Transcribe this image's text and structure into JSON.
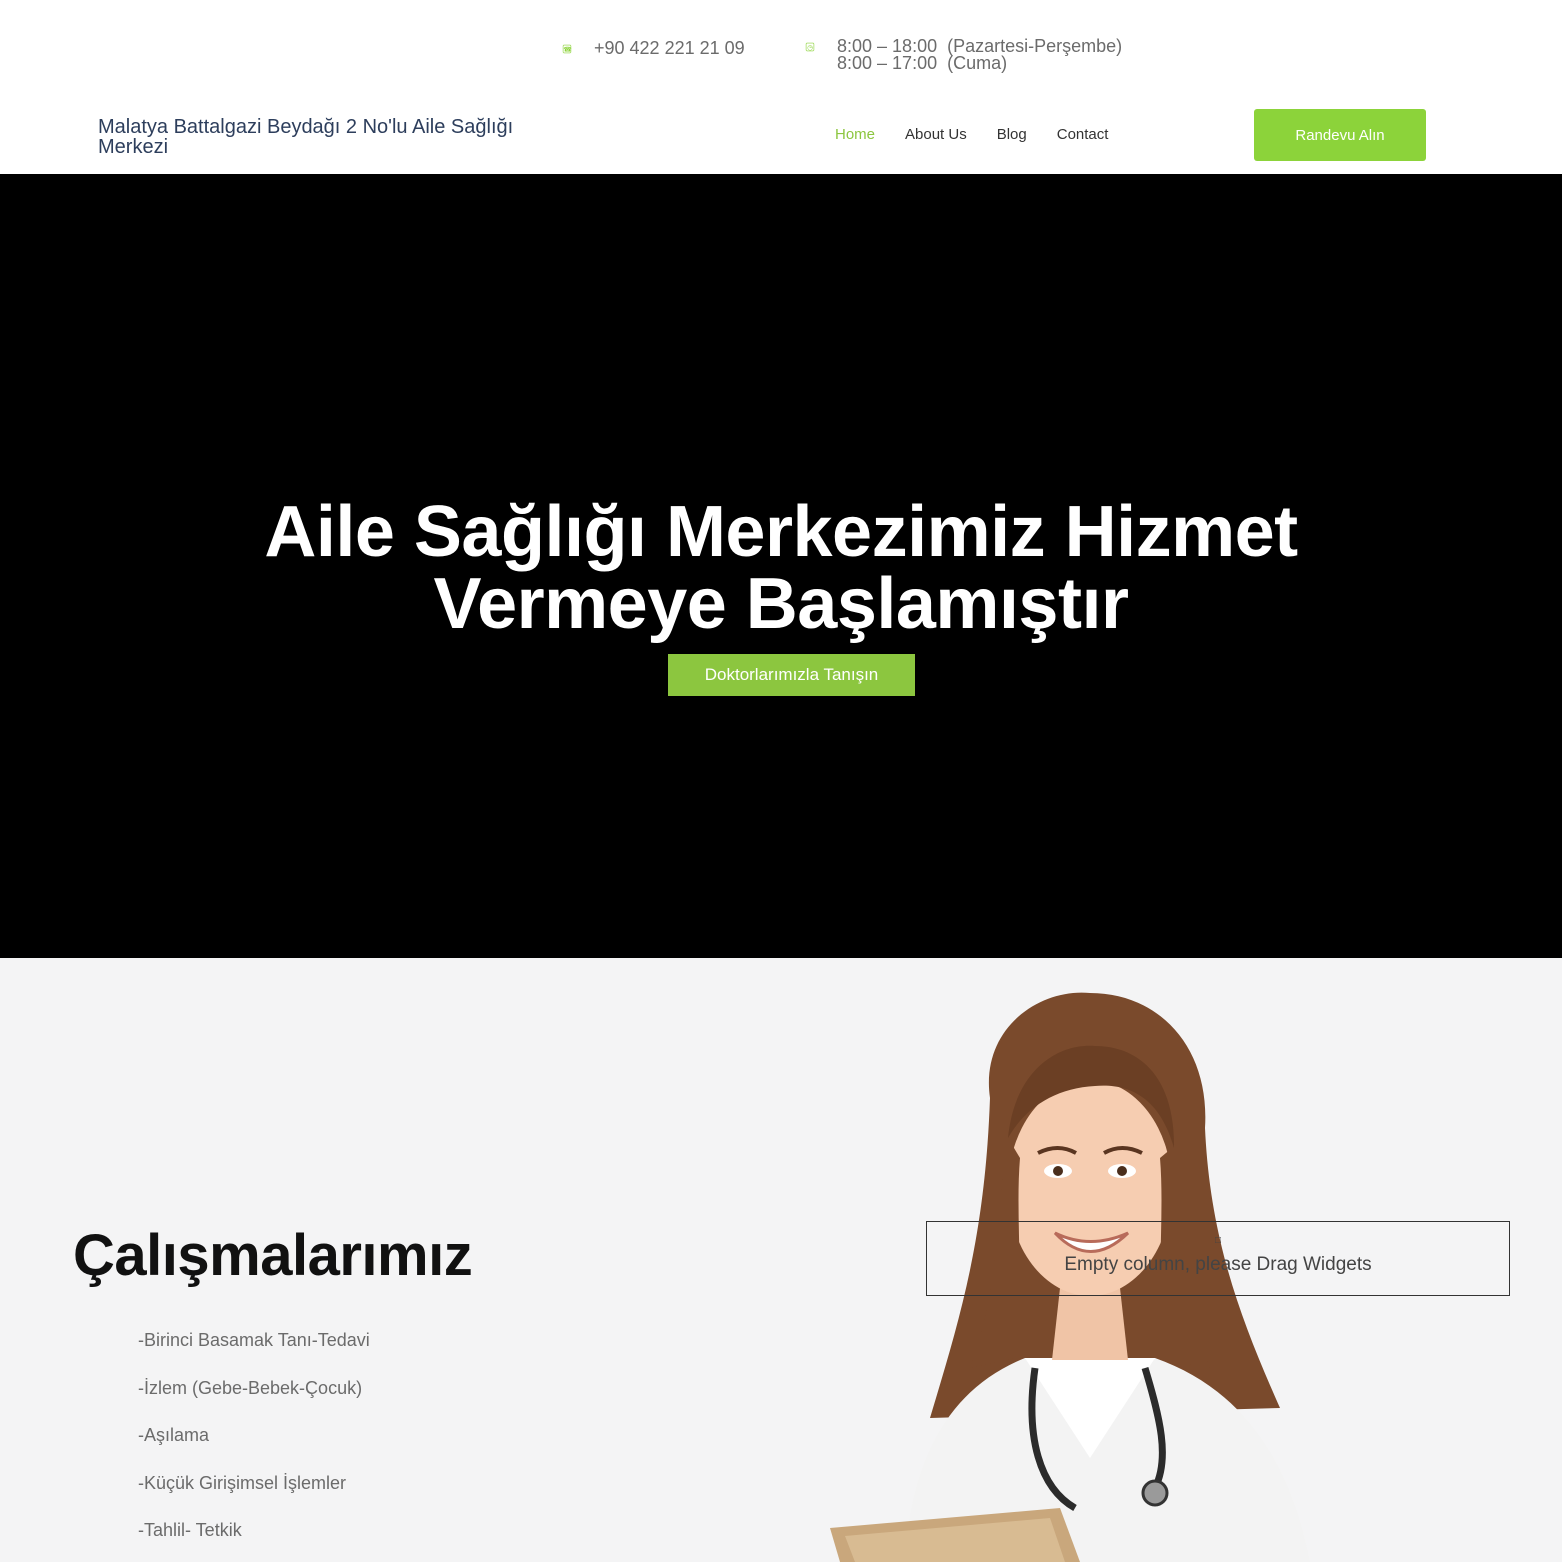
{
  "topbar": {
    "phone": "+90 422 221 21 09",
    "hours_line1": "8:00 – 18:00  (Pazartesi-Perşembe)",
    "hours_line2": "8:00 – 17:00  (Cuma)",
    "phone_icon": "phone-icon",
    "clock_icon": "clock-icon",
    "accent_color": "#8cd33a"
  },
  "header": {
    "brand": "Malatya Battalgazi Beydağı 2 No'lu Aile Sağlığı Merkezi",
    "nav": [
      {
        "label": "Home",
        "active": true
      },
      {
        "label": "About Us",
        "active": false
      },
      {
        "label": "Blog",
        "active": false
      },
      {
        "label": "Contact",
        "active": false
      }
    ],
    "cta_label": "Randevu Alın",
    "brand_color": "#2d3e5c"
  },
  "hero": {
    "title_line1": "Aile Sağlığı Merkezimiz Hizmet",
    "title_line2": "Vermeye Başlamıştır",
    "button_label": "Doktorlarımızla Tanışın",
    "background": "#000000"
  },
  "works": {
    "title": "Çalışmalarımız",
    "items": [
      "-Birinci Basamak Tanı-Tedavi",
      "-İzlem (Gebe-Bebek-Çocuk)",
      "-Aşılama",
      "-Küçük Girişimsel İşlemler",
      "-Tahlil- Tetkik"
    ],
    "empty_column_text": "Empty column, please Drag Widgets",
    "empty_column_icon": "plus-icon"
  }
}
